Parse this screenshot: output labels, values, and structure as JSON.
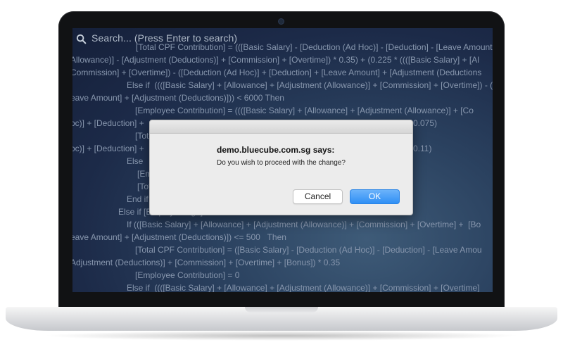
{
  "search": {
    "placeholder": "Search... (Press Enter to search)"
  },
  "code_lines": [
    "[Total CPF Contribution] = (([Basic Salary] - [Deduction (Ad Hoc)] - [Deduction] - [Leave Amount",
    "Allowance)] - [Adjustment (Deductions)] + [Commission] + [Overtime]) * 0.35) + (0.225 * ((([Basic Salary] + [Al",
    "Commission] + [Overtime]) - ([Deduction (Ad Hoc)] + [Deduction] + [Leave Amount] + [Adjustment (Deductions",
    "Else if  ((([Basic Salary] + [Allowance] + [Adjustment (Allowance)] + [Commission] + [Overtime]) - ([Deductio",
    "eave Amount] + [Adjustment (Deductions)])) < 6000 Then",
    "[Employee Contribution] = ((([Basic Salary] + [Allowance] + [Adjustment (Allowance)] + [Co",
    "oc)] + [Deduction] +",
    "0.075)",
    "[Tot",
    "oc)] + [Deduction] +",
    "0.11)",
    "Else",
    "[Em",
    "[Tot",
    "End if",
    "Else if [Employee Age] <= 60 Then",
    "If (([Basic Salary] + [Allowance] + [Adjustment (Allowance)] + [Commission] + [Overtime] +  [Bo",
    "eave Amount] + [Adjustment (Deductions)]) <= 500   Then",
    "[Total CPF Contribution] = ([Basic Salary] - [Deduction (Ad Hoc)] - [Deduction] - [Leave Amou",
    "Adjustment (Deductions)] + [Commission] + [Overtime] + [Bonus]) * 0.35",
    "[Employee Contribution] = 0",
    "Else if  ((([Basic Salary] + [Allowance] + [Adjustment (Allowance)] + [Commission] + [Overtime]"
  ],
  "dialog": {
    "title": "demo.bluecube.com.sg says:",
    "message": "Do you wish to proceed with the change?",
    "cancel_label": "Cancel",
    "ok_label": "OK"
  },
  "colors": {
    "ok_button": "#2f8ff5",
    "screen_bg": "#1c2a48"
  },
  "icons": {
    "search": "search-icon"
  }
}
